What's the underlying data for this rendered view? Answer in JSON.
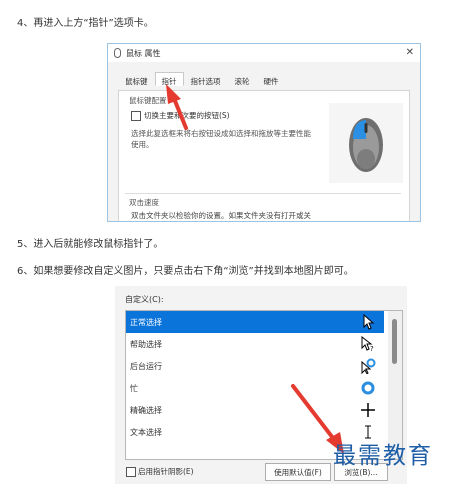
{
  "steps": {
    "s4": "4、再进入上方“指针”选项卡。",
    "s5": "5、进入后就能修改鼠标指针了。",
    "s6": "6、如果想要修改自定义图片，只要点击右下角“浏览”并找到本地图片即可。"
  },
  "dialog1": {
    "title": "鼠标 属性",
    "tabs": [
      "鼠标键",
      "指针",
      "指针选项",
      "滚轮",
      "硬件"
    ],
    "group_buttons": "鼠标键配置",
    "swap_checkbox_label": "切换主要和次要的按钮(S)",
    "swap_description": "选择此复选框来将右按钮设成如选择和拖放等主要性能使用。",
    "group_double_click": "双击速度",
    "double_click_desc": "双击文件夹以检验你的设置。如果文件夹没有打开或关"
  },
  "dialog2": {
    "custom_label": "自定义(C):",
    "cursor_rows": [
      {
        "label": "正常选择",
        "icon": "arrow-cursor-icon",
        "selected": true
      },
      {
        "label": "帮助选择",
        "icon": "help-cursor-icon",
        "selected": false
      },
      {
        "label": "后台运行",
        "icon": "working-cursor-icon",
        "selected": false
      },
      {
        "label": "忙",
        "icon": "busy-cursor-icon",
        "selected": false
      },
      {
        "label": "精确选择",
        "icon": "crosshair-cursor-icon",
        "selected": false
      },
      {
        "label": "文本选择",
        "icon": "text-cursor-icon",
        "selected": false
      }
    ],
    "shadow_checkbox_label": "启用指针阴影(E)",
    "default_button": "使用默认值(F)",
    "browse_button": "浏览(B)..."
  },
  "watermark": "最需教育",
  "colors": {
    "selection_blue": "#0a74da",
    "arrow_red": "#e43a2f",
    "ring_blue": "#2a8fe0",
    "watermark_blue": "#1e5ea6"
  }
}
